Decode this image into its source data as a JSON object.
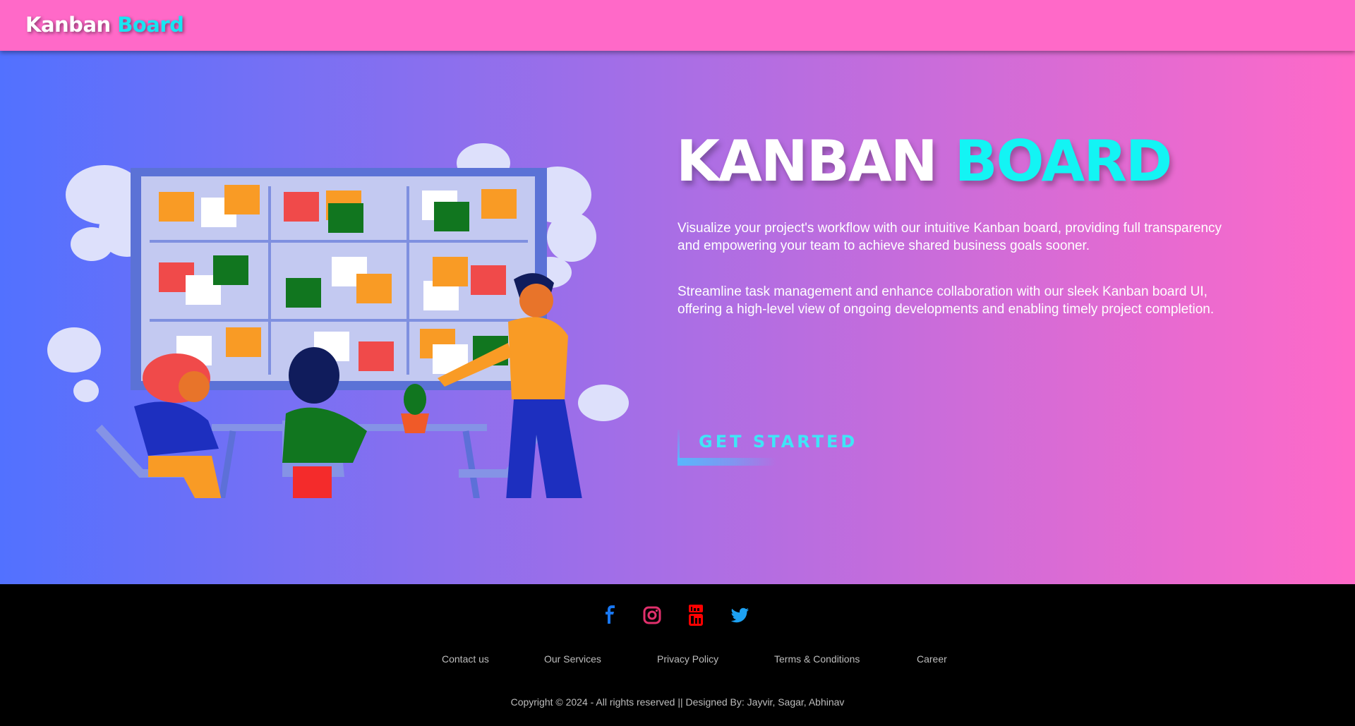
{
  "navbar": {
    "brand_part1": "Kanban",
    "brand_part2": "Board"
  },
  "hero": {
    "title_part1": "KANBAN",
    "title_part2": "BOARD",
    "paragraph1": "Visualize your project's workflow with our intuitive Kanban board, providing full transparency and empowering your team to achieve shared business goals sooner.",
    "paragraph2": "Streamline task management and enhance collaboration with our sleek Kanban board UI, offering a high-level view of ongoing developments and enabling timely project completion.",
    "cta_label": "GET STARTED",
    "illustration": "team-kanban-illustration"
  },
  "footer": {
    "social": [
      {
        "icon": "facebook-icon",
        "color": "#1877f2"
      },
      {
        "icon": "instagram-icon",
        "color": "#e1306c"
      },
      {
        "icon": "youtube-icon",
        "color": "#ff0000"
      },
      {
        "icon": "twitter-icon",
        "color": "#1da1f2"
      }
    ],
    "links": [
      "Contact us",
      "Our Services",
      "Privacy Policy",
      "Terms & Conditions",
      "Career"
    ],
    "copyright": "Copyright © 2024 - All rights reserved || Designed By: Jayvir, Sagar, Abhinav"
  },
  "colors": {
    "navbar": "#ff69c8",
    "accent_cyan": "#13f4f4",
    "gradient_start": "#5271ff",
    "gradient_end": "#ff69c8",
    "footer": "#000000"
  }
}
